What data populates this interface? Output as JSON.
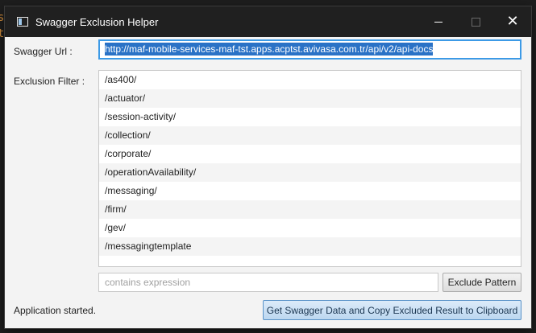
{
  "window": {
    "title": "Swagger Exclusion Helper",
    "close_glyph": "✕"
  },
  "form": {
    "url_label": "Swagger Url :",
    "url_value": "http://maf-mobile-services-maf-tst.apps.acptst.avivasa.com.tr/api/v2/api-docs",
    "filter_label": "Exclusion Filter :",
    "exclusions": [
      "/as400/",
      "/actuator/",
      "/session-activity/",
      "/collection/",
      "/corporate/",
      "/operationAvailability/",
      "/messaging/",
      "/firm/",
      "/gev/",
      "/messagingtemplate"
    ],
    "pattern_placeholder": "contains expression",
    "exclude_button": "Exclude Pattern"
  },
  "footer": {
    "status": "Application started.",
    "action_button": "Get Swagger Data and Copy Excluded Result to Clipboard"
  },
  "colors": {
    "accent": "#3c9ae6",
    "selection": "#2a72c6",
    "titlebar": "#202020"
  }
}
